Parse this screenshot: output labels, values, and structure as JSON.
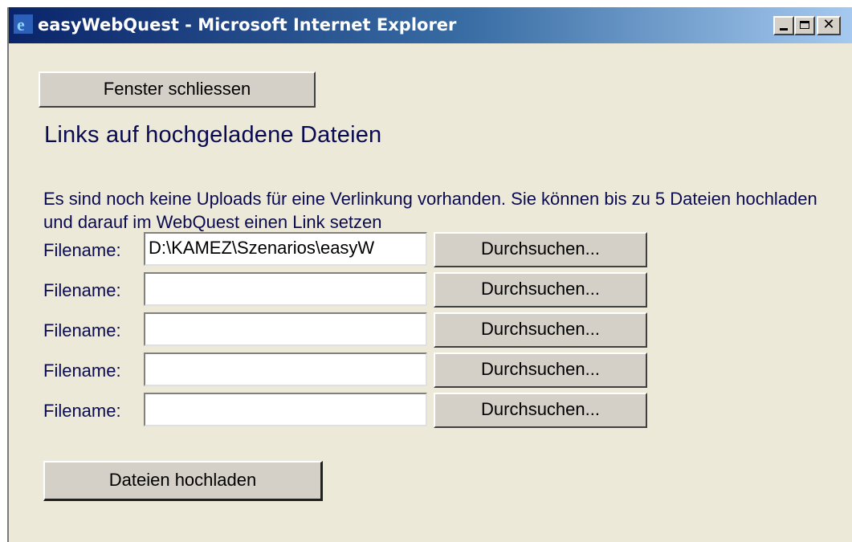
{
  "window": {
    "title": "easyWebQuest - Microsoft Internet Explorer",
    "controls": [
      "minimize",
      "maximize",
      "close"
    ]
  },
  "page": {
    "close_button_label": "Fenster schliessen",
    "heading": "Links auf hochgeladene Dateien",
    "info_text": "Es sind noch keine Uploads für eine Verlinkung vorhanden. Sie können bis zu 5 Dateien hochladen und darauf im WebQuest einen Link setzen",
    "file_rows": [
      {
        "label": "Filename:",
        "value": "D:\\KAMEZ\\Szenarios\\easyW",
        "browse_label": "Durchsuchen..."
      },
      {
        "label": "Filename:",
        "value": "",
        "browse_label": "Durchsuchen..."
      },
      {
        "label": "Filename:",
        "value": "",
        "browse_label": "Durchsuchen..."
      },
      {
        "label": "Filename:",
        "value": "",
        "browse_label": "Durchsuchen..."
      },
      {
        "label": "Filename:",
        "value": "",
        "browse_label": "Durchsuchen..."
      }
    ],
    "upload_button_label": "Dateien hochladen"
  },
  "colors": {
    "titlebar_start": "#0a246a",
    "titlebar_end": "#a6caf0",
    "background": "#ece9d8",
    "text": "#0a0a50"
  },
  "icons": {
    "title": "internet-explorer-icon"
  }
}
